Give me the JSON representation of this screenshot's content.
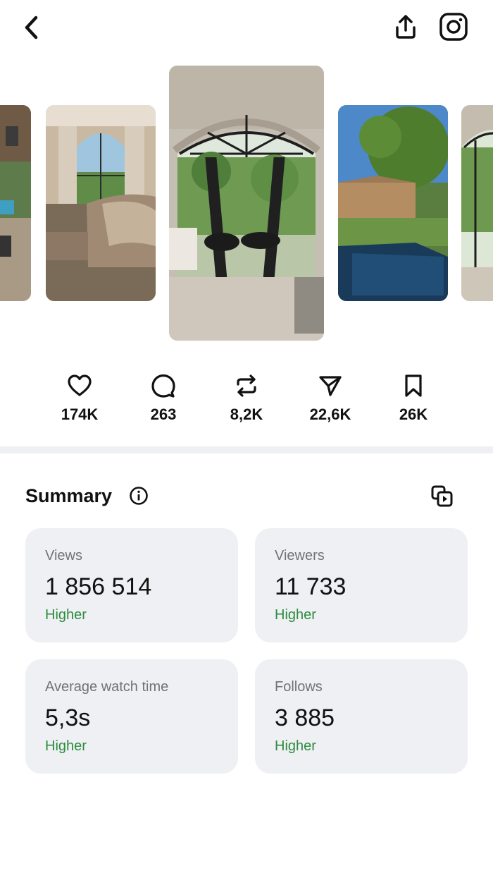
{
  "header": {
    "back_icon": "chevron-left-icon",
    "share_icon": "share-upload-icon",
    "instagram_icon": "instagram-icon"
  },
  "stats": [
    {
      "icon": "heart-icon",
      "value": "174K"
    },
    {
      "icon": "comment-icon",
      "value": "263"
    },
    {
      "icon": "repost-icon",
      "value": "8,2K"
    },
    {
      "icon": "send-icon",
      "value": "22,6K"
    },
    {
      "icon": "bookmark-icon",
      "value": "26K"
    }
  ],
  "summary": {
    "title": "Summary",
    "info_icon": "info-icon",
    "export_icon": "copy-video-icon",
    "cards": [
      {
        "label": "Views",
        "value": "1 856 514",
        "trend": "Higher"
      },
      {
        "label": "Viewers",
        "value": "11 733",
        "trend": "Higher"
      },
      {
        "label": "Average watch time",
        "value": "5,3s",
        "trend": "Higher"
      },
      {
        "label": "Follows",
        "value": "3 885",
        "trend": "Higher"
      }
    ]
  },
  "colors": {
    "trend_positive": "#2e8b3e",
    "card_bg": "#eef0f4",
    "divider": "#eef0f3"
  }
}
